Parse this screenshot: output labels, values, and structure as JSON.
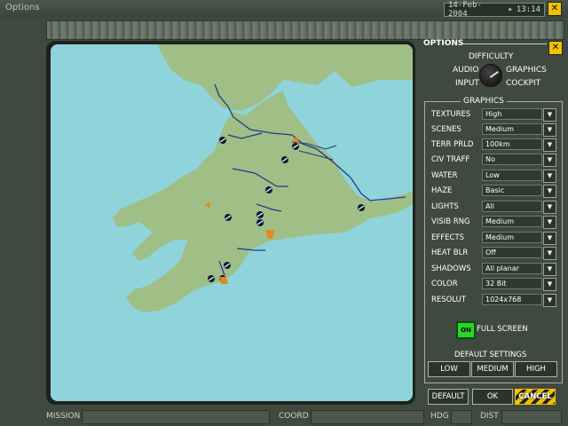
{
  "window": {
    "title": "Options",
    "date": "14-Feb-2004",
    "time": "13:14"
  },
  "options_panel": {
    "title": "OPTIONS",
    "knob_labels": {
      "difficulty": "DIFFICULTY",
      "audio": "AUDIO",
      "graphics": "GRAPHICS",
      "input": "INPUT",
      "cockpit": "COCKPIT"
    }
  },
  "graphics": {
    "title": "GRAPHICS",
    "settings": [
      {
        "label": "TEXTURES",
        "value": "High"
      },
      {
        "label": "SCENES",
        "value": "Medium"
      },
      {
        "label": "TERR PRLD",
        "value": "100km"
      },
      {
        "label": "CIV TRAFF",
        "value": "No"
      },
      {
        "label": "WATER",
        "value": "Low"
      },
      {
        "label": "HAZE",
        "value": "Basic"
      },
      {
        "label": "LIGHTS",
        "value": "All"
      },
      {
        "label": "VISIB RNG",
        "value": "Medium"
      },
      {
        "label": "EFFECTS",
        "value": "Medium"
      },
      {
        "label": "HEAT BLR",
        "value": "Off"
      },
      {
        "label": "SHADOWS",
        "value": "All planar"
      },
      {
        "label": "COLOR",
        "value": "32 Bit"
      },
      {
        "label": "RESOLUT",
        "value": "1024x768"
      }
    ],
    "full_screen": {
      "toggle": "ON",
      "label": "FULL SCREEN"
    },
    "default_settings": {
      "label": "DEFAULT SETTINGS",
      "low": "LOW",
      "medium": "MEDIUM",
      "high": "HIGH"
    }
  },
  "actions": {
    "default": "DEFAULT",
    "ok": "OK",
    "cancel": "CANCEL"
  },
  "statusbar": {
    "mission": "MISSION",
    "coord": "COORD",
    "hdg": "HDG",
    "dist": "DIST"
  },
  "colors": {
    "sea": "#8fd3db",
    "land": "#9fbf86",
    "river": "#1f3a8a",
    "accent_yellow": "#f2c200",
    "on_green": "#29d629"
  },
  "icons": {
    "close": "close-icon",
    "dropdown": "chevron-down-icon",
    "airfield": "airfield-icon",
    "target": "target-icon"
  }
}
